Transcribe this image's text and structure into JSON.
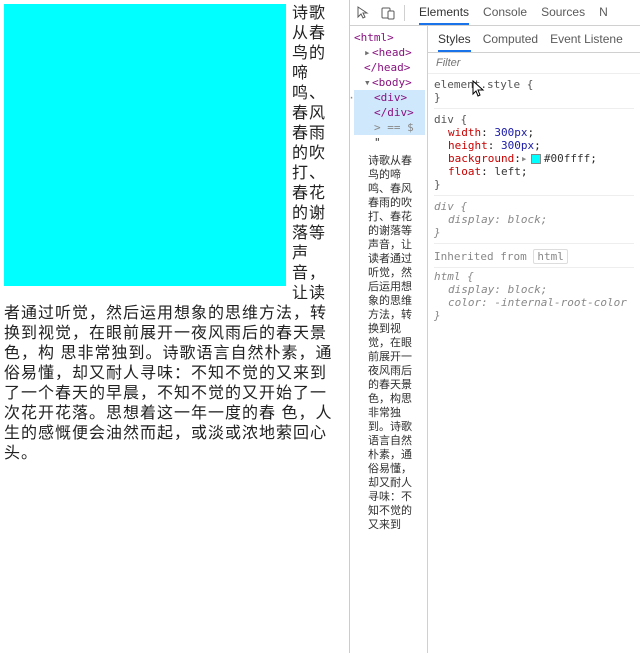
{
  "page": {
    "body_text": "诗歌从春鸟的啼鸣、春风春雨的吹打、春花的谢落等声音，让读者通过听觉，然后运用想象的思维方法，转换到视觉，在眼前展开一夜风雨后的春天景色，构 思非常独到。诗歌语言自然朴素，通俗易懂，却又耐人寻味：不知不觉的又来到 了一个春天的早晨，不知不觉的又开始了一次花开花落。思想着这一年一度的春 色，人生的感慨便会油然而起，或淡或浓地萦回心头。",
    "box_color": "#00ffff"
  },
  "devtools": {
    "tabs": [
      "Elements",
      "Console",
      "Sources",
      "N"
    ],
    "active_tab": "Elements",
    "dom": {
      "l0": "<html>",
      "l1": "<head>",
      "l2": "</head>",
      "l3": "<body>",
      "l4": "<div>",
      "l5": "</div>",
      "l6": "== $",
      "l7": "\"",
      "after_text": "诗歌从春鸟的啼鸣、春风春雨的吹打、春花的谢落等声音，让读者通过听觉，然后运用想象的思维方法，转换到视觉，在眼前展开一夜风雨后的春天景色，构思非常独到。诗歌语言自然朴素，通俗易懂，却又耐人寻味：不知不觉的又来到"
    },
    "styles": {
      "tabs": [
        "Styles",
        "Computed",
        "Event Listene"
      ],
      "active_tab": "Styles",
      "filter_placeholder": "Filter",
      "rules": {
        "r0_sel": "element.style {",
        "r0_end": "}",
        "r1_sel": "div {",
        "r1_p0": "width",
        "r1_v0": "300px",
        "r1_p1": "height",
        "r1_v1": "300px",
        "r1_p2": "background",
        "r1_v2": "#00ffff",
        "r1_p3": "float",
        "r1_v3": "left",
        "r2_sel": "div {",
        "r2_p0": "display",
        "r2_v0": "block",
        "inherit_label": "Inherited from ",
        "inherit_link": "html",
        "r3_sel": "html {",
        "r3_p0": "display",
        "r3_v0": "block",
        "r3_p1": "color",
        "r3_v1": "-internal-root-color"
      }
    }
  }
}
